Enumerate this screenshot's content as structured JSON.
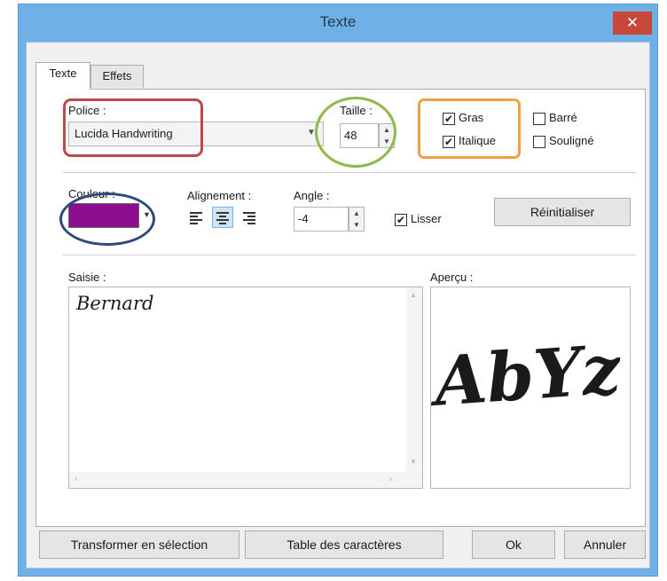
{
  "window": {
    "title": "Texte",
    "close_glyph": "✕"
  },
  "tabs": [
    {
      "label": "Texte"
    },
    {
      "label": "Effets"
    }
  ],
  "font": {
    "label": "Police :",
    "value": "Lucida Handwriting"
  },
  "size": {
    "label": "Taille :",
    "value": "48"
  },
  "style": {
    "bold": {
      "label": "Gras",
      "checked": true
    },
    "italic": {
      "label": "Italique",
      "checked": true
    },
    "strike": {
      "label": "Barré",
      "checked": false
    },
    "underline": {
      "label": "Souligné",
      "checked": false
    }
  },
  "color": {
    "label": "Couleur :",
    "value": "#8b0f8f"
  },
  "alignment": {
    "label": "Alignement :",
    "options": [
      "left",
      "center",
      "right"
    ],
    "selected": "center"
  },
  "angle": {
    "label": "Angle :",
    "value": "-4"
  },
  "smooth": {
    "label": "Lisser",
    "checked": true
  },
  "reset_button": "Réinitialiser",
  "input": {
    "label": "Saisie :",
    "text": "Bernard"
  },
  "preview": {
    "label": "Aperçu :",
    "sample": "AbYz"
  },
  "footer": {
    "transform": "Transformer en sélection",
    "charmap": "Table des caractères",
    "ok": "Ok",
    "cancel": "Annuler"
  },
  "annotation_colors": {
    "red": "#b94a4a",
    "green": "#8db84a",
    "orange": "#f0a040",
    "navy": "#2f4a78"
  }
}
